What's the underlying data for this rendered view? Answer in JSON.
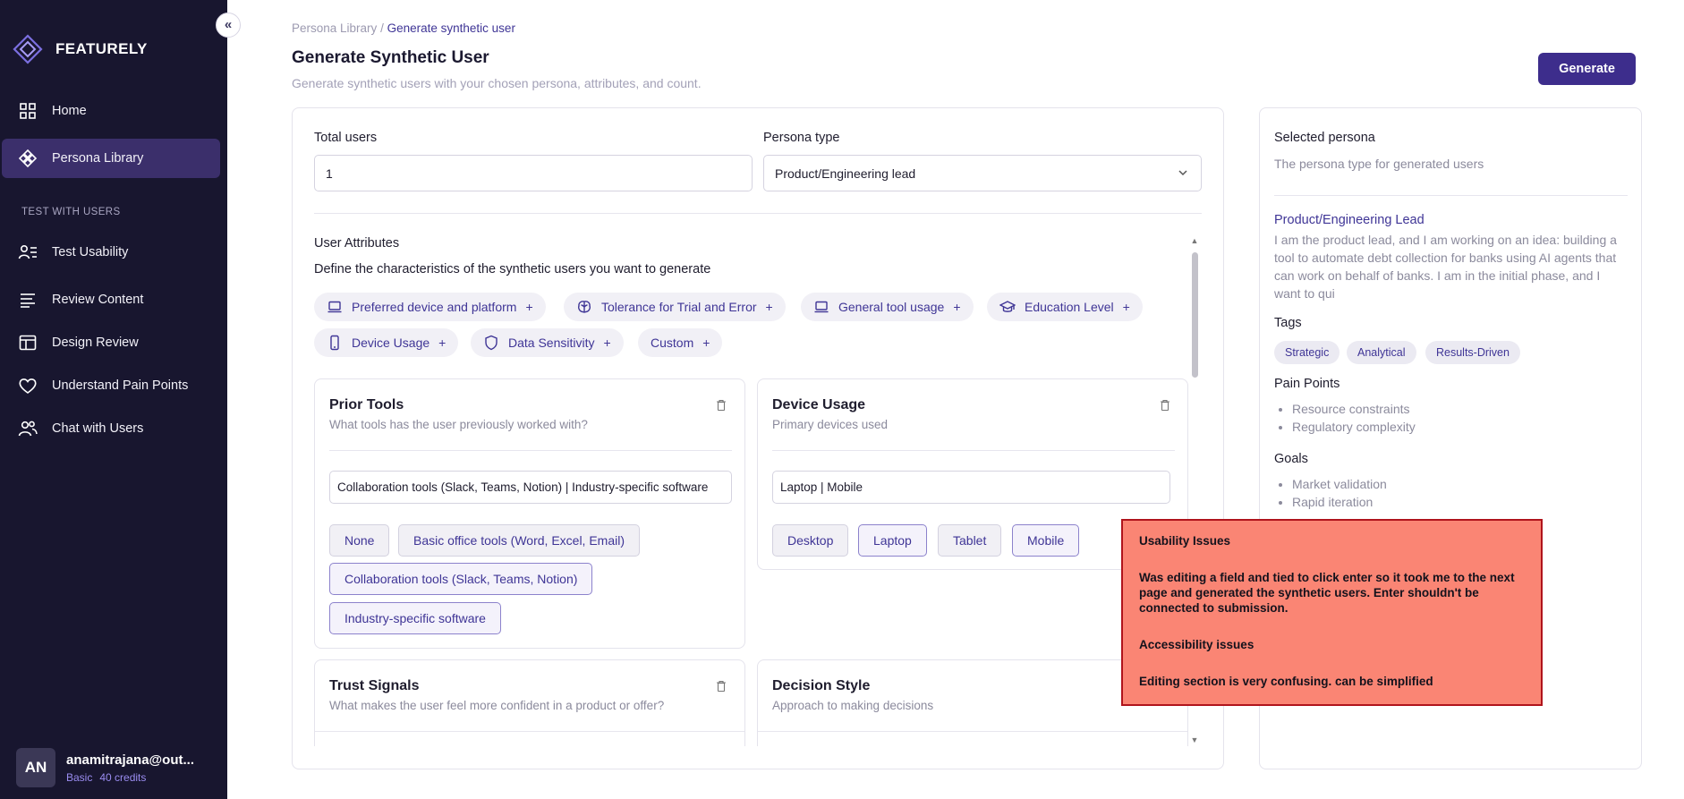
{
  "sidebar": {
    "collapse_icon": "«",
    "brand": "FEATURELY",
    "items": [
      {
        "label": "Home",
        "icon": "grid-icon"
      },
      {
        "label": "Persona Library",
        "icon": "diamond-nodes-icon",
        "active": true
      }
    ],
    "section_label": "TEST WITH USERS",
    "test_items": [
      {
        "label": "Test Usability",
        "icon": "user-list-icon"
      },
      {
        "label": "Review Content",
        "icon": "lines-icon"
      },
      {
        "label": "Design Review",
        "icon": "layout-icon"
      },
      {
        "label": "Understand Pain Points",
        "icon": "heart-icon"
      },
      {
        "label": "Chat with Users",
        "icon": "users-icon"
      }
    ],
    "user": {
      "initials": "AN",
      "email": "anamitrajana@out...",
      "plan": "Basic",
      "credits": "40 credits"
    }
  },
  "header": {
    "breadcrumb_parent": "Persona Library",
    "breadcrumb_sep": "/",
    "breadcrumb_current": "Generate synthetic user",
    "title": "Generate Synthetic User",
    "subtitle": "Generate synthetic users with your chosen persona, attributes, and count.",
    "generate_label": "Generate"
  },
  "form": {
    "total_users_label": "Total users",
    "total_users_value": "1",
    "persona_type_label": "Persona type",
    "persona_type_value": "Product/Engineering lead",
    "attributes_title": "User Attributes",
    "attributes_sub": "Define the characteristics of the synthetic users you want to generate",
    "chips": [
      {
        "label": "Preferred device and platform",
        "icon": "laptop-icon"
      },
      {
        "label": "Tolerance for Trial and Error",
        "icon": "brain-icon"
      },
      {
        "label": "General tool usage",
        "icon": "laptop-icon"
      },
      {
        "label": "Education Level",
        "icon": "graduation-cap-icon"
      },
      {
        "label": "Device Usage",
        "icon": "phone-icon"
      },
      {
        "label": "Data Sensitivity",
        "icon": "shield-icon"
      },
      {
        "label": "Custom",
        "icon": ""
      }
    ],
    "chip_plus": "+"
  },
  "cards": {
    "prior_tools": {
      "title": "Prior Tools",
      "sub": "What tools has the user previously worked with?",
      "value": "Collaboration tools (Slack, Teams, Notion) | Industry-specific software",
      "options": [
        "None",
        "Basic office tools (Word, Excel, Email)",
        "Collaboration tools (Slack, Teams, Notion)",
        "Industry-specific software"
      ]
    },
    "device_usage": {
      "title": "Device Usage",
      "sub": "Primary devices used",
      "value": "Laptop | Mobile",
      "options": [
        "Desktop",
        "Laptop",
        "Tablet",
        "Mobile"
      ]
    },
    "trust_signals": {
      "title": "Trust Signals",
      "sub": "What makes the user feel more confident in a product or offer?"
    },
    "decision_style": {
      "title": "Decision Style",
      "sub": "Approach to making decisions"
    }
  },
  "persona": {
    "heading": "Selected persona",
    "sub": "The persona type for generated users",
    "name": "Product/Engineering Lead",
    "description": "I am the product lead, and I am working on an idea: building a tool to automate debt collection for banks using AI agents that can work on behalf of banks. I am in the initial phase, and I want to qui",
    "tags_heading": "Tags",
    "tags": [
      "Strategic",
      "Analytical",
      "Results-Driven"
    ],
    "pain_heading": "Pain Points",
    "pain_points": [
      "Resource constraints",
      "Regulatory complexity"
    ],
    "goals_heading": "Goals",
    "goals": [
      "Market validation",
      "Rapid iteration"
    ]
  },
  "annotation": {
    "h1": "Usability Issues",
    "p1": "Was editing a field and tied to click enter so it took me to the next page and generated the synthetic users. Enter shouldn't be connected to submission.",
    "h2": "Accessibility issues",
    "p2": "Editing section is very confusing. can be simplified",
    "bg_color": "#fa8574",
    "border_color": "#b0141c"
  },
  "colors": {
    "sidebar_bg": "#18162f",
    "accent": "#3d2d8c",
    "active_nav": "#3b2f6b"
  }
}
